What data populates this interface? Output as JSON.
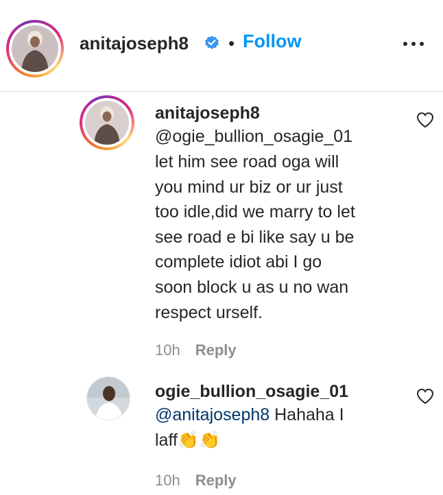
{
  "header": {
    "username": "anitajoseph8",
    "separator": "•",
    "follow_label": "Follow",
    "verified_icon": "verified-badge-icon",
    "more_icon": "more-options-icon"
  },
  "comments": [
    {
      "username": "anitajoseph8",
      "mention": "@ogie_bullion_osagie_01",
      "text": "let him see road oga will\nyou mind ur biz or ur just\ntoo idle,did we marry to let\nsee road e bi like say u be\ncomplete idiot abi I go\nsoon block u as u no wan\nrespect urself.",
      "time": "10h",
      "reply_label": "Reply",
      "like_icon": "heart-icon"
    },
    {
      "username": "ogie_bullion_osagie_01",
      "mention": "@anitajoseph8",
      "text_line1": " Hahaha I",
      "text_line2": "laff👏👏",
      "time": "10h",
      "reply_label": "Reply",
      "like_icon": "heart-icon"
    }
  ],
  "colors": {
    "link_blue": "#0095f6",
    "mention_blue": "#00376b",
    "text": "#262626",
    "muted": "#8e8e8e",
    "divider": "#dbdbdb"
  }
}
